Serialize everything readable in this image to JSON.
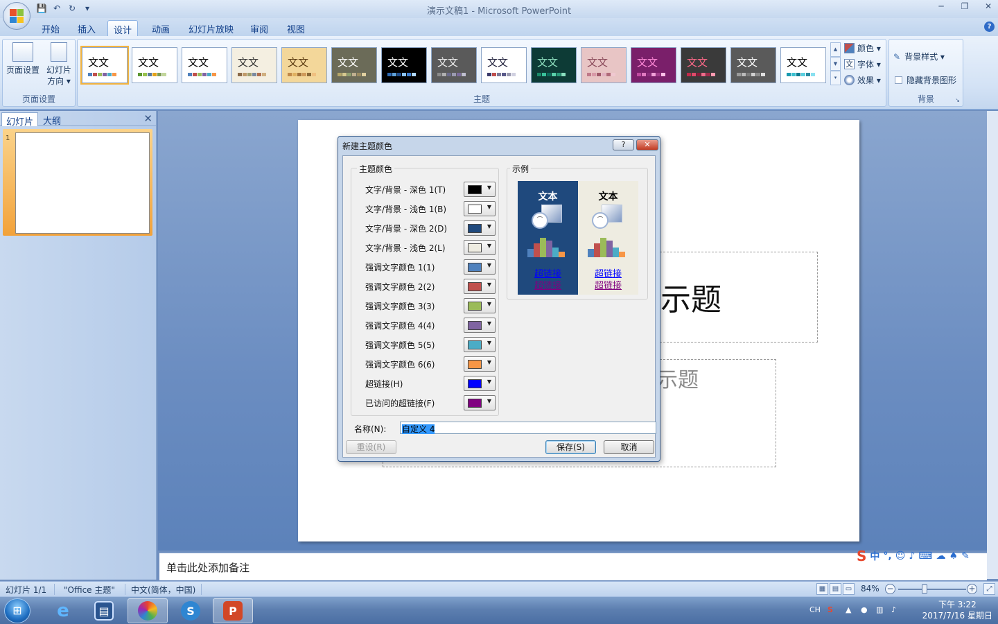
{
  "window": {
    "title": "演示文稿1 - Microsoft PowerPoint",
    "controls": [
      "─",
      "❐",
      "✕"
    ]
  },
  "tabs": [
    {
      "label": "开始"
    },
    {
      "label": "插入"
    },
    {
      "label": "设计",
      "active": true
    },
    {
      "label": "动画"
    },
    {
      "label": "幻灯片放映"
    },
    {
      "label": "审阅"
    },
    {
      "label": "视图"
    }
  ],
  "ribbon": {
    "page_setup_group": {
      "label": "页面设置",
      "page_setup_button": "页面设置",
      "orientation_button_line1": "幻灯片",
      "orientation_button_line2": "方向 ▾"
    },
    "themes_group": {
      "label": "主题",
      "theme_sample_text": "文文",
      "themes": [
        {
          "bg": "#ffffff",
          "fg": "#000000",
          "sw": [
            "#4f81bd",
            "#c0504d",
            "#9bbb59",
            "#8064a2",
            "#4bacc6",
            "#f79646"
          ]
        },
        {
          "bg": "#ffffff",
          "fg": "#000000",
          "sw": [
            "#5d9732",
            "#99c24d",
            "#5a7a9c",
            "#e3a21a",
            "#7a9a52",
            "#c2d69b"
          ]
        },
        {
          "bg": "#ffffff",
          "fg": "#000000",
          "sw": [
            "#4f81bd",
            "#c0504d",
            "#9bbb59",
            "#8064a2",
            "#4bacc6",
            "#f79646"
          ]
        },
        {
          "bg": "#f4efe1",
          "fg": "#333333",
          "sw": [
            "#8a6a4a",
            "#c09a6a",
            "#a0a070",
            "#7a8aa0",
            "#b07050",
            "#d0b080"
          ]
        },
        {
          "bg": "#f3d79a",
          "fg": "#5a3a10",
          "sw": [
            "#c0894a",
            "#e0b060",
            "#a0703a",
            "#d09a5a",
            "#8a6a3a",
            "#f0c080"
          ]
        },
        {
          "bg": "#6b6b58",
          "fg": "#ffffff",
          "sw": [
            "#b5a66a",
            "#d6c98f",
            "#8f9f6f",
            "#c0b090",
            "#9a8a60",
            "#e0d0a0"
          ]
        },
        {
          "bg": "#000000",
          "fg": "#ffffff",
          "sw": [
            "#2e6ab4",
            "#5fa0d8",
            "#1c4a8a",
            "#8ac0f0",
            "#3a7acc",
            "#b0d8ff"
          ]
        },
        {
          "bg": "#5a5a5a",
          "fg": "#eeeeee",
          "sw": [
            "#8a8a8a",
            "#b0b0b0",
            "#6a6a8a",
            "#9a9ab0",
            "#7a6a9a",
            "#c0c0d0"
          ]
        },
        {
          "bg": "#ffffff",
          "fg": "#1f1f3a",
          "sw": [
            "#3a3a6a",
            "#c0504d",
            "#7a7a9a",
            "#5a5a8a",
            "#9a9ab0",
            "#d0d0e0"
          ]
        },
        {
          "bg": "#0d3b36",
          "fg": "#8fe0c0",
          "sw": [
            "#1a8a6a",
            "#3ac09a",
            "#0a6a5a",
            "#5ad0aa",
            "#2a9a7a",
            "#8ae0c0"
          ]
        },
        {
          "bg": "#e8c5c5",
          "fg": "#8a4a5a",
          "sw": [
            "#c07a8a",
            "#d89aa8",
            "#a05a6a",
            "#e0b0c0",
            "#b06a7a",
            "#f0c8d0"
          ]
        },
        {
          "bg": "#7a1f6a",
          "fg": "#ff8ad8",
          "sw": [
            "#c04aa0",
            "#e07ac0",
            "#8a2a7a",
            "#f0a0d8",
            "#a03a8a",
            "#ffc0e8"
          ]
        },
        {
          "bg": "#3a3a3a",
          "fg": "#ff6a8a",
          "sw": [
            "#c02a4a",
            "#e04a6a",
            "#8a1a3a",
            "#f06a8a",
            "#a02a4a",
            "#ff9ab0"
          ]
        },
        {
          "bg": "#5a5a5a",
          "fg": "#ffffff",
          "sw": [
            "#9a9a9a",
            "#bababa",
            "#7a7a7a",
            "#d0d0d0",
            "#8a8a8a",
            "#e0e0e0"
          ]
        },
        {
          "bg": "#ffffff",
          "fg": "#000000",
          "sw": [
            "#1a9ab0",
            "#3ac0d0",
            "#0a7a90",
            "#5ad0e0",
            "#2a8aa0",
            "#8ae0f0"
          ]
        }
      ],
      "colors_label": "颜色 ▾",
      "fonts_label": "字体 ▾",
      "effects_label": "效果 ▾"
    },
    "background_group": {
      "label": "背景",
      "bg_styles_label": "背景样式 ▾",
      "hide_bg_label": "隐藏背景图形"
    }
  },
  "left_pane": {
    "tab_slides": "幻灯片",
    "tab_outline": "大纲",
    "close": "✕",
    "slide_number": "1"
  },
  "slide": {
    "title_fragment": "示题",
    "subtitle_fragment": "示题"
  },
  "notes_placeholder": "单击此处添加备注",
  "dialog": {
    "title": "新建主题颜色",
    "help_btn": "?",
    "close_btn": "✕",
    "theme_colors_legend": "主题颜色",
    "sample_legend": "示例",
    "rows": [
      {
        "label": "文字/背景 - 深色 1(T)",
        "color": "#000000"
      },
      {
        "label": "文字/背景 - 浅色 1(B)",
        "color": "#ffffff"
      },
      {
        "label": "文字/背景 - 深色 2(D)",
        "color": "#1f497d"
      },
      {
        "label": "文字/背景 - 浅色 2(L)",
        "color": "#eeece1"
      },
      {
        "label": "强调文字颜色 1(1)",
        "color": "#4f81bd"
      },
      {
        "label": "强调文字颜色 2(2)",
        "color": "#c0504d"
      },
      {
        "label": "强调文字颜色 3(3)",
        "color": "#9bbb59"
      },
      {
        "label": "强调文字颜色 4(4)",
        "color": "#8064a2"
      },
      {
        "label": "强调文字颜色 5(5)",
        "color": "#4bacc6"
      },
      {
        "label": "强调文字颜色 6(6)",
        "color": "#f79646"
      },
      {
        "label": "超链接(H)",
        "color": "#0000ff"
      },
      {
        "label": "已访问的超链接(F)",
        "color": "#800080"
      }
    ],
    "preview": {
      "text": "文本",
      "hyperlink": "超链接",
      "visited": "超链接"
    },
    "name_label": "名称(N):",
    "name_value": "自定义 4",
    "reset_btn": "重设(R)",
    "save_btn": "保存(S)",
    "cancel_btn": "取消"
  },
  "statusbar": {
    "slide_info": "幻灯片 1/1",
    "theme": "\"Office 主题\"",
    "language": "中文(简体，中国)",
    "zoom": "84%"
  },
  "taskbar": {
    "lang": "CH",
    "time": "下午 3:22",
    "date": "2017/7/16 星期日"
  }
}
